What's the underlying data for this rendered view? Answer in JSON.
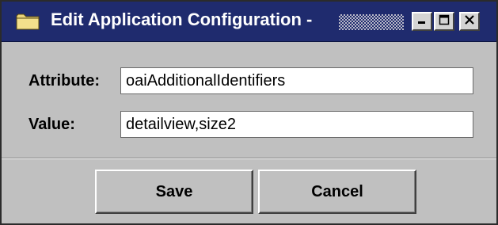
{
  "window": {
    "title": "Edit Application Configuration -",
    "controls": {
      "minimize_icon": "minimize-icon",
      "maximize_icon": "maximize-icon",
      "close_icon": "close-icon"
    },
    "title_icon": "folder-icon"
  },
  "form": {
    "attribute_label": "Attribute:",
    "attribute_value": "oaiAdditionalIdentifiers",
    "value_label": "Value:",
    "value_value": "detailview,size2"
  },
  "buttons": {
    "save_label": "Save",
    "cancel_label": "Cancel"
  },
  "colors": {
    "titlebar": "#1f2b6e",
    "window_bg": "#c0c0c0",
    "field_bg": "#ffffff"
  }
}
